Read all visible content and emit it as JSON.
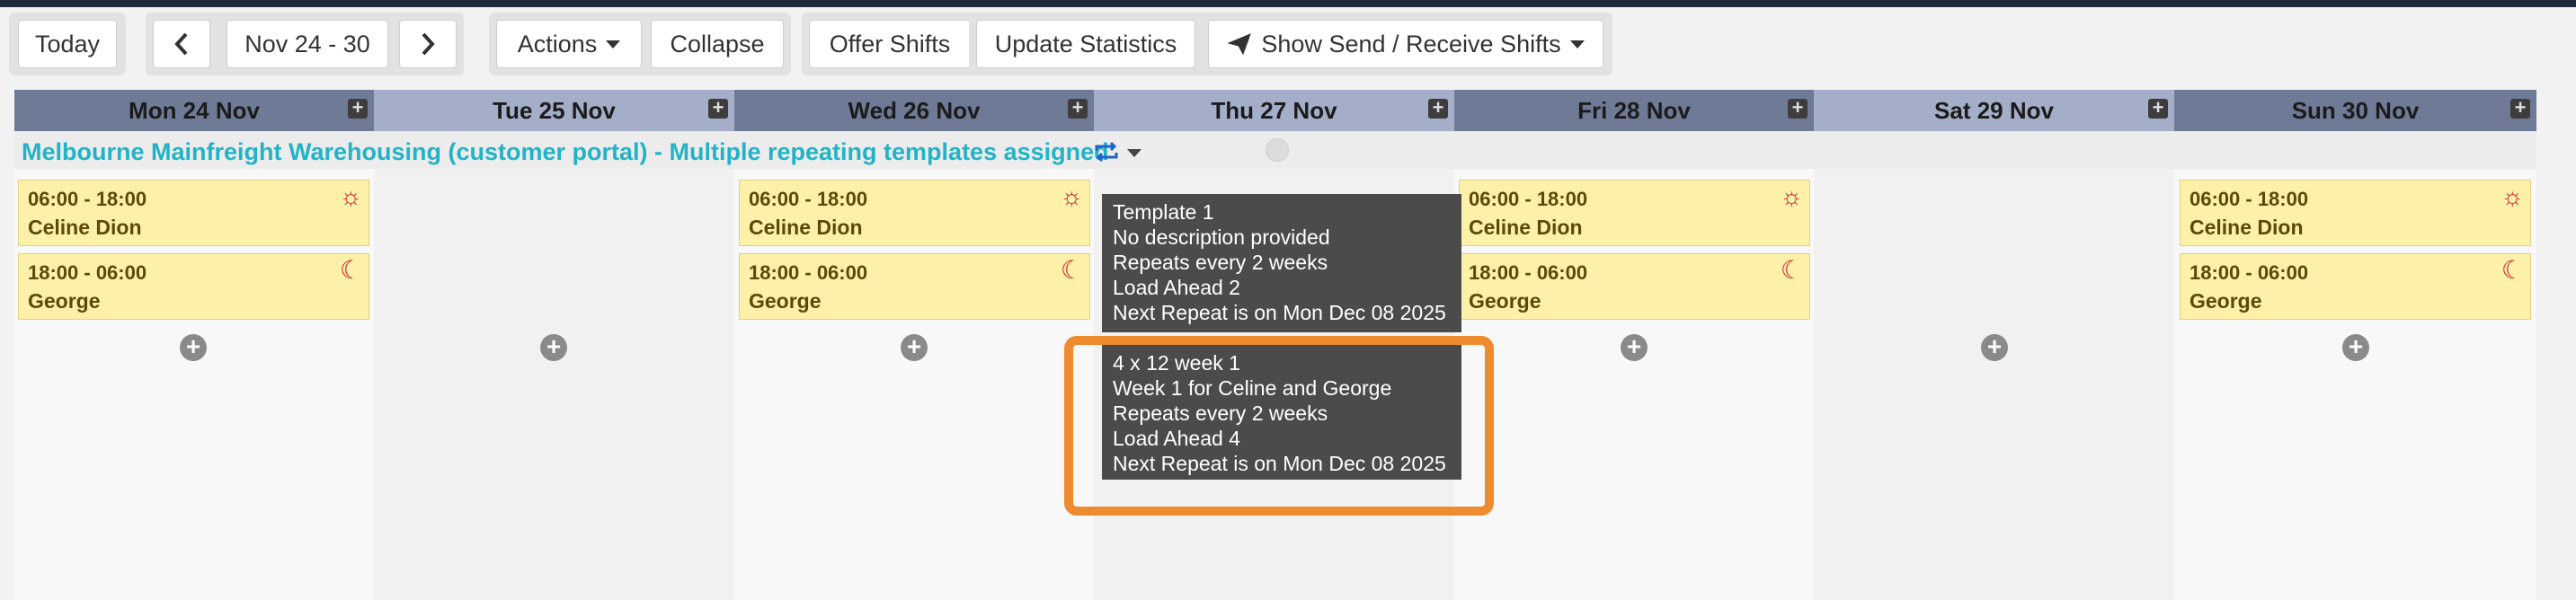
{
  "toolbar": {
    "today": "Today",
    "date_range": "Nov 24 - 30",
    "actions": "Actions",
    "collapse": "Collapse",
    "offer_shifts": "Offer Shifts",
    "update_statistics": "Update Statistics",
    "send_receive": "Show Send / Receive Shifts"
  },
  "days": [
    "Mon 24 Nov",
    "Tue 25 Nov",
    "Wed 26 Nov",
    "Thu 27 Nov",
    "Fri 28 Nov",
    "Sat 29 Nov",
    "Sun 30 Nov"
  ],
  "group": {
    "label": "Melbourne Mainfreight Warehousing (customer portal) - Multiple repeating templates assigned"
  },
  "shifts": {
    "mon_day": {
      "time": "06:00 - 18:00",
      "name": "Celine Dion"
    },
    "mon_night": {
      "time": "18:00 - 06:00",
      "name": "George"
    },
    "wed_day": {
      "time": "06:00 - 18:00",
      "name": "Celine Dion"
    },
    "wed_night": {
      "time": "18:00 - 06:00",
      "name": "George"
    },
    "fri_day": {
      "time": "06:00 - 18:00",
      "name": "Celine Dion"
    },
    "fri_night": {
      "time": "18:00 - 06:00",
      "name": "George"
    },
    "sun_day": {
      "time": "06:00 - 18:00",
      "name": "Celine Dion"
    },
    "sun_night": {
      "time": "18:00 - 06:00",
      "name": "George"
    }
  },
  "tooltips": [
    {
      "name": "Template 1",
      "description": "No description provided",
      "repeats": "Repeats every 2 weeks",
      "load_ahead": "Load Ahead 2",
      "next_repeat": "Next Repeat is on Mon Dec 08 2025"
    },
    {
      "name": "4 x 12 week 1",
      "description": "Week 1 for Celine and George",
      "repeats": "Repeats every 2 weeks",
      "load_ahead": "Load Ahead 4",
      "next_repeat": "Next Repeat is on Mon Dec 08 2025"
    }
  ],
  "icons": {
    "day_shift": "sun-icon",
    "night_shift": "moon-icon",
    "repeat": "repeat-icon",
    "add": "plus-circle-icon"
  },
  "colors": {
    "group_text": "#22b3c6",
    "shift_bg": "#fdf0a8",
    "shift_icon": "#d0202a",
    "highlight": "#ee8b2e"
  }
}
